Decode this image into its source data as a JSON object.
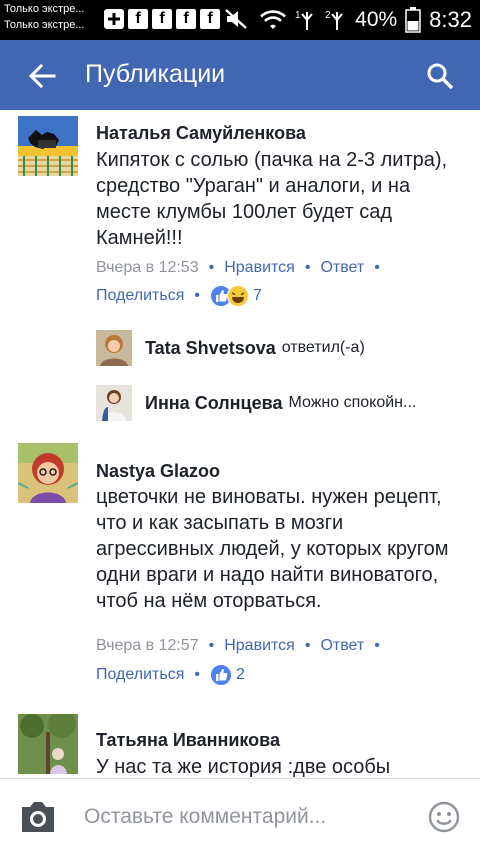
{
  "status_bar": {
    "notifications": [
      "Только экстре...",
      "Только экстре..."
    ],
    "battery_percent": "40%",
    "time": "8:32",
    "network_labels": [
      "1",
      "2"
    ]
  },
  "app_bar": {
    "title": "Публикации",
    "accent_color": "#4267b2"
  },
  "comments": [
    {
      "author": "Наталья Самуйленкова",
      "text": "Кипяток с  солью (пачка на 2-3 литра), средство \"Ураган\" и аналоги, и на месте клумбы 100лет будет сад Камней!!!",
      "time": "Вчера в 12:53",
      "like_label": "Нравится",
      "reply_label": "Ответ",
      "share_label": "Поделиться",
      "reactions_count": "7",
      "replies": [
        {
          "author": "Tata Shvetsova",
          "text": "ответил(-а)"
        },
        {
          "author": "Инна Солнцева",
          "text": "Можно спокойн..."
        }
      ]
    },
    {
      "author": "Nastya Glazoo",
      "text": "цветочки не виноваты. нужен рецепт, что и как засыпать в мозги агрессивных людей, у которых кругом одни враги и надо найти виноватого, чтоб на нём оторваться.",
      "time": "Вчера в 12:57",
      "like_label": "Нравится",
      "reply_label": "Ответ",
      "share_label": "Поделиться",
      "reactions_count": "2"
    },
    {
      "author": "Татьяна Иванникова",
      "text": "У нас та же история :две особы пожилого возраста"
    }
  ],
  "composer": {
    "placeholder": "Оставьте комментарий..."
  }
}
